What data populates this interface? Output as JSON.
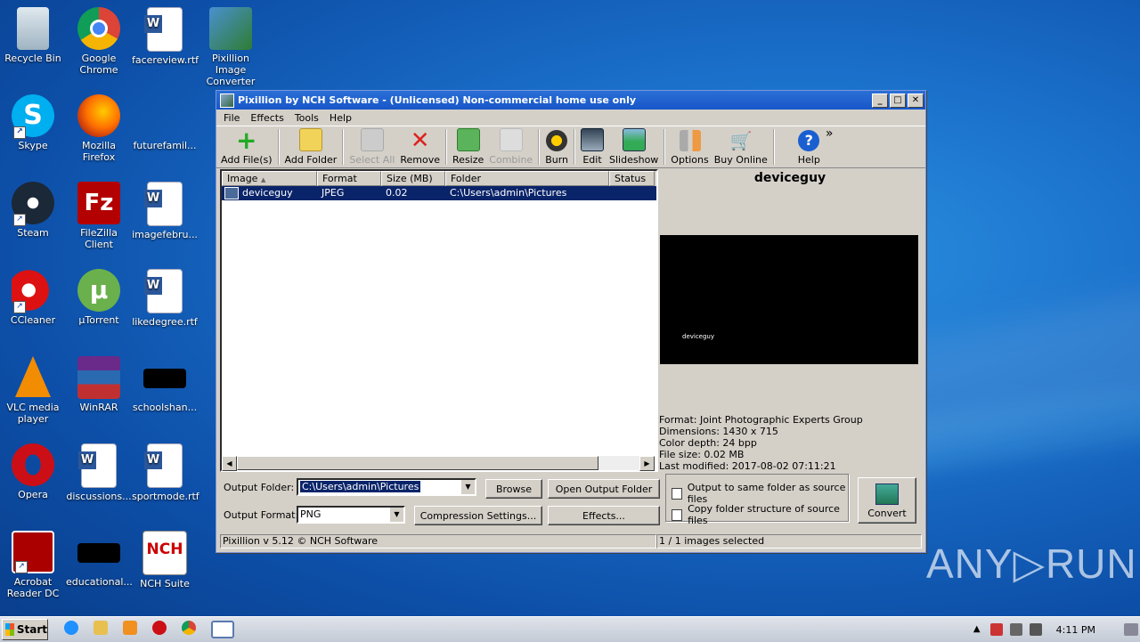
{
  "desktop": {
    "icons": [
      {
        "label": "Recycle Bin"
      },
      {
        "label": "Google\nChrome"
      },
      {
        "label": "facereview.rtf"
      },
      {
        "label": "Pixillion Image\nConverter"
      },
      {
        "label": "Skype"
      },
      {
        "label": "Mozilla Firefox"
      },
      {
        "label": "futurefamil..."
      },
      {
        "label": "Steam"
      },
      {
        "label": "FileZilla Client"
      },
      {
        "label": "imagefebru..."
      },
      {
        "label": "CCleaner"
      },
      {
        "label": "µTorrent"
      },
      {
        "label": "likedegree.rtf"
      },
      {
        "label": "VLC media\nplayer"
      },
      {
        "label": "WinRAR"
      },
      {
        "label": "schoolshan..."
      },
      {
        "label": "Opera"
      },
      {
        "label": "discussions..."
      },
      {
        "label": "sportmode.rtf"
      },
      {
        "label": "Acrobat\nReader DC"
      },
      {
        "label": "educational..."
      },
      {
        "label": "NCH Suite"
      }
    ],
    "watermark": "ANY▷RUN"
  },
  "window": {
    "title": "Pixillion by NCH Software - (Unlicensed) Non-commercial home use only",
    "controls": {
      "minimize": "_",
      "maximize": "□",
      "close": "✕"
    },
    "menu": [
      "File",
      "Effects",
      "Tools",
      "Help"
    ],
    "toolbar": {
      "add_files": "Add File(s)",
      "add_folder": "Add Folder",
      "select_all": "Select All",
      "remove": "Remove",
      "resize": "Resize",
      "combine": "Combine",
      "burn": "Burn",
      "edit": "Edit",
      "slideshow": "Slideshow",
      "options": "Options",
      "buy_online": "Buy Online",
      "help": "Help",
      "more": "»"
    },
    "list": {
      "columns": [
        "Image",
        "Format",
        "Size (MB)",
        "Folder",
        "Status"
      ],
      "sort_indicator": "▲",
      "rows": [
        {
          "image": "deviceguy",
          "format": "JPEG",
          "size": "0.02",
          "folder": "C:\\Users\\admin\\Pictures",
          "status": ""
        }
      ]
    },
    "preview": {
      "name": "deviceguy",
      "image_caption": "deviceguy",
      "info": {
        "format": "Format: Joint Photographic Experts Group",
        "dimensions": "Dimensions: 1430 x 715",
        "color_depth": "Color depth: 24 bpp",
        "file_size": "File size: 0.02 MB",
        "last_modified": "Last modified: 2017-08-02 07:11:21"
      }
    },
    "output": {
      "folder_label": "Output Folder:",
      "folder_value": "C:\\Users\\admin\\Pictures",
      "browse": "Browse",
      "open_output_folder": "Open Output Folder",
      "format_label": "Output Format:",
      "format_value": "PNG",
      "compression_settings": "Compression Settings...",
      "effects": "Effects...",
      "same_folder": "Output to same folder as source files",
      "copy_structure": "Copy folder structure of source files",
      "convert": "Convert"
    },
    "status": {
      "version": "Pixillion v 5.12 © NCH Software",
      "selection": "1 / 1 images selected"
    }
  },
  "taskbar": {
    "start": "Start",
    "clock": "4:11 PM"
  },
  "colors": {
    "titlebar": "#1856c8",
    "selection": "#0a246a",
    "desktop": "#1a6fc9"
  }
}
